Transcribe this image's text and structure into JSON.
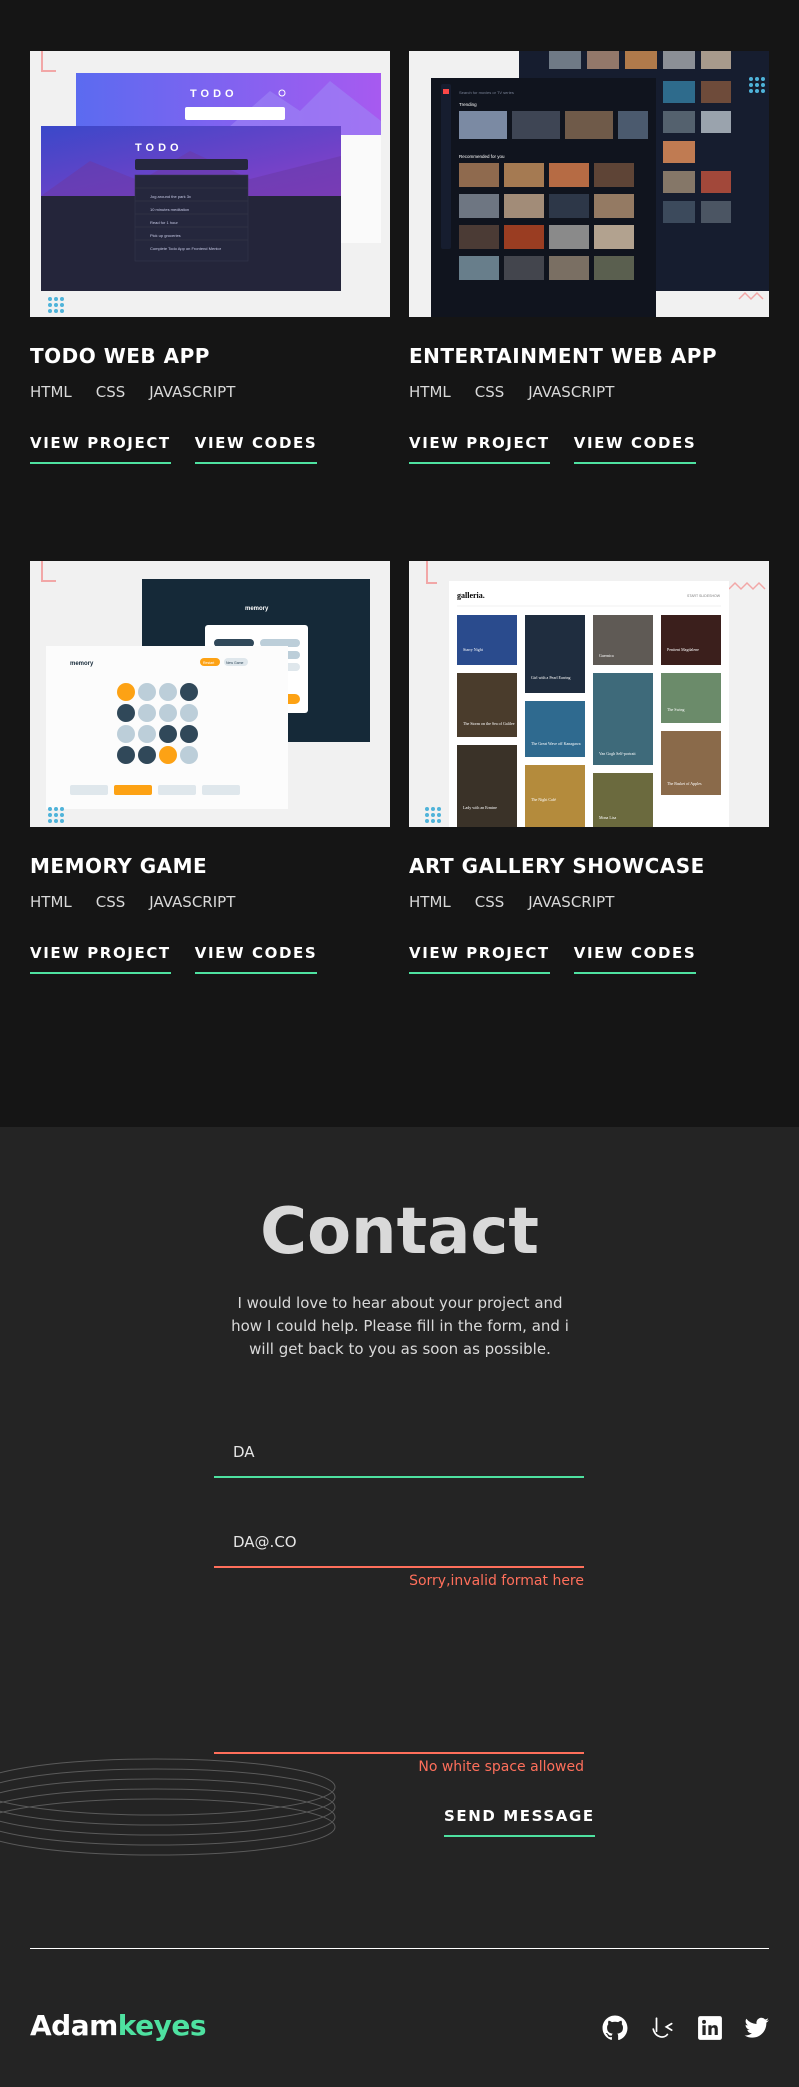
{
  "projects": [
    {
      "title": "TODO WEB APP",
      "tags": [
        "HTML",
        "CSS",
        "JAVASCRIPT"
      ],
      "view_project": "VIEW PROJECT",
      "view_codes": "VIEW CODES",
      "thumb": {
        "app_title_back": "TODO",
        "app_title_front": "TODO",
        "input_placeholder_back": "Create a new todo...",
        "input_placeholder_front": "Create a new todo...",
        "items": [
          "Jog around the park 3x",
          "10 minutes meditation",
          "Read for 1 hour",
          "Pick up groceries",
          "Complete Todo App on Frontend Mentor"
        ]
      }
    },
    {
      "title": "ENTERTAINMENT WEB APP",
      "tags": [
        "HTML",
        "CSS",
        "JAVASCRIPT"
      ],
      "view_project": "VIEW PROJECT",
      "view_codes": "VIEW CODES",
      "thumb": {
        "search_placeholder": "Search for movies or TV series",
        "trending_label": "Trending",
        "recommended_label": "Recommended for you"
      }
    },
    {
      "title": "MEMORY GAME",
      "tags": [
        "HTML",
        "CSS",
        "JAVASCRIPT"
      ],
      "view_project": "VIEW PROJECT",
      "view_codes": "VIEW CODES",
      "thumb": {
        "brand_back": "memory",
        "brand_front": "memory",
        "restart_label": "Restart",
        "new_game_label": "New Game"
      }
    },
    {
      "title": "ART GALLERY SHOWCASE",
      "tags": [
        "HTML",
        "CSS",
        "JAVASCRIPT"
      ],
      "view_project": "VIEW PROJECT",
      "view_codes": "VIEW CODES",
      "thumb": {
        "brand": "galleria.",
        "slideshow_label": "START SLIDESHOW",
        "paintings": [
          "Starry Night",
          "Girl with a Pearl Earring",
          "Guernica",
          "Penitent Magdalene",
          "The Storm on the Sea of Galilee",
          "The Great Wave off Kanagawa",
          "Van Gogh Self-portrait",
          "The Swing",
          "Lady with an Ermine",
          "The Night Café",
          "Mona Lisa",
          "The Basket of Apples"
        ]
      }
    }
  ],
  "contact": {
    "title": "Contact",
    "description": "I would love to hear about your project and how I could help. Please fill in the form, and i will get back to you as soon as possible.",
    "name_value": "DA",
    "email_value": "DA@.CO",
    "email_error": "Sorry,invalid format here",
    "message_value": "",
    "message_error": "No white space allowed",
    "send_label": "SEND MESSAGE"
  },
  "footer": {
    "logo_first": "Adam",
    "logo_second": "keyes",
    "social": [
      "github-icon",
      "frontend-mentor-icon",
      "linkedin-icon",
      "twitter-icon"
    ]
  },
  "colors": {
    "accent": "#4ee1a0",
    "error": "#ff6f5b",
    "background_dark": "#151515",
    "background_contact": "#242424"
  }
}
